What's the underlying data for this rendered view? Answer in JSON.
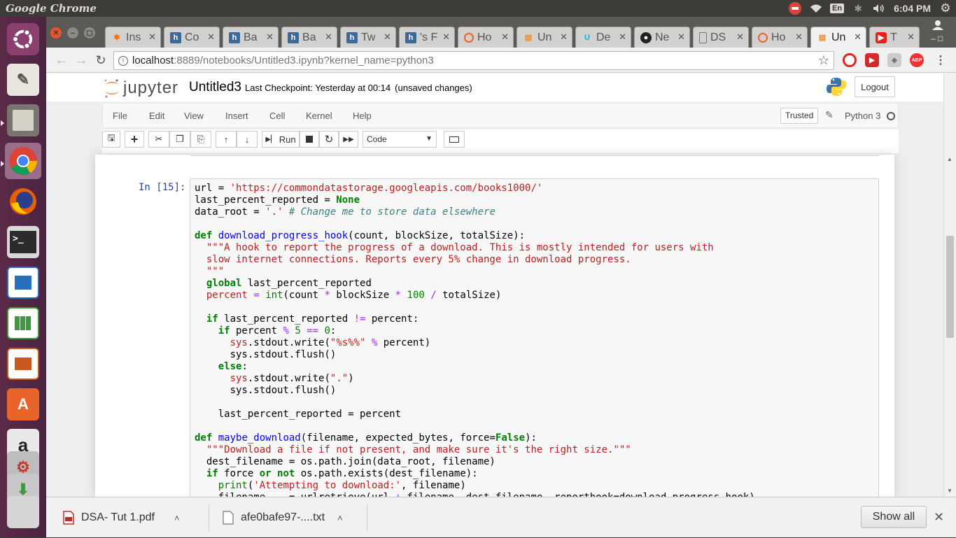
{
  "os_panel": {
    "app_title": "Google Chrome",
    "keyboard_layout": "En",
    "clock": "6:04 PM"
  },
  "launcher": {
    "items": [
      "ubuntu-dash",
      "text-editor",
      "file-manager",
      "chrome",
      "firefox",
      "terminal",
      "libreoffice-writer",
      "libreoffice-calc",
      "libreoffice-impress",
      "ubuntu-software",
      "amazon",
      "system-settings",
      "updater",
      "workspaces"
    ]
  },
  "tabs": [
    {
      "label": "Ins",
      "icon": "tensorflow-icon"
    },
    {
      "label": "Co",
      "icon": "h-icon"
    },
    {
      "label": "Ba",
      "icon": "h-icon"
    },
    {
      "label": "Ba",
      "icon": "h-icon"
    },
    {
      "label": "Tw",
      "icon": "h-icon"
    },
    {
      "label": "'s F",
      "icon": "h-icon"
    },
    {
      "label": "Ho",
      "icon": "circle-icon"
    },
    {
      "label": "Un",
      "icon": "book-icon"
    },
    {
      "label": "De",
      "icon": "udacity-icon"
    },
    {
      "label": "Ne",
      "icon": "github-icon"
    },
    {
      "label": "DS",
      "icon": "document-icon"
    },
    {
      "label": "Ho",
      "icon": "circle-icon"
    },
    {
      "label": "Un",
      "icon": "book-icon",
      "active": true
    },
    {
      "label": "T",
      "icon": "youtube-icon"
    }
  ],
  "address": {
    "host": "localhost",
    "rest": ":8889/notebooks/Untitled3.ipynb?kernel_name=python3"
  },
  "notebook": {
    "logo_text": "jupyter",
    "name": "Untitled3",
    "checkpoint": "Last Checkpoint: Yesterday at 00:14",
    "unsaved": "(unsaved changes)",
    "logout_label": "Logout",
    "menu": [
      "File",
      "Edit",
      "View",
      "Insert",
      "Cell",
      "Kernel",
      "Help"
    ],
    "trusted_label": "Trusted",
    "kernel_name": "Python 3",
    "toolbar": {
      "run_label": "Run",
      "cell_type": "Code"
    },
    "cell": {
      "prompt": "In [15]:"
    }
  },
  "downloads": {
    "items": [
      {
        "name": "DSA- Tut 1.pdf",
        "icon": "pdf-icon"
      },
      {
        "name": "afe0bafe97-....txt",
        "icon": "text-file-icon"
      }
    ],
    "show_all_label": "Show all"
  },
  "colors": {
    "ubuntu_panel": "#3c3b37",
    "launcher": "#5c2b48",
    "jupyter_orange": "#f37726",
    "prompt_blue": "#303f9f"
  }
}
